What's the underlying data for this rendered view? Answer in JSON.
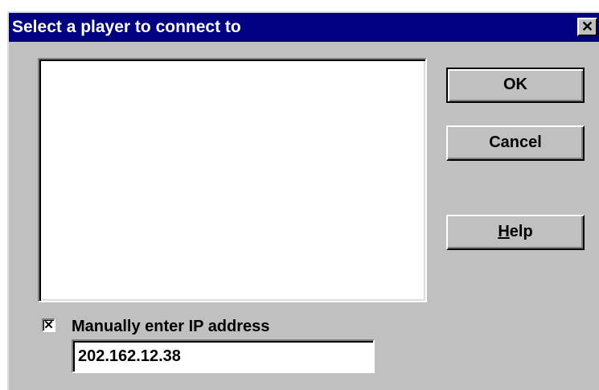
{
  "window": {
    "title": "Select a player to connect to",
    "close_glyph": "✕",
    "colors": {
      "titlebar": "#000080",
      "face": "#c0c0c0"
    }
  },
  "player_list": {
    "items": []
  },
  "buttons": {
    "ok_label": "OK",
    "cancel_label": "Cancel",
    "help_mnemonic": "H",
    "help_rest": "elp"
  },
  "manual_ip": {
    "checked": true,
    "check_glyph": "✕",
    "label": "Manually enter IP address",
    "value": "202.162.12.38"
  }
}
